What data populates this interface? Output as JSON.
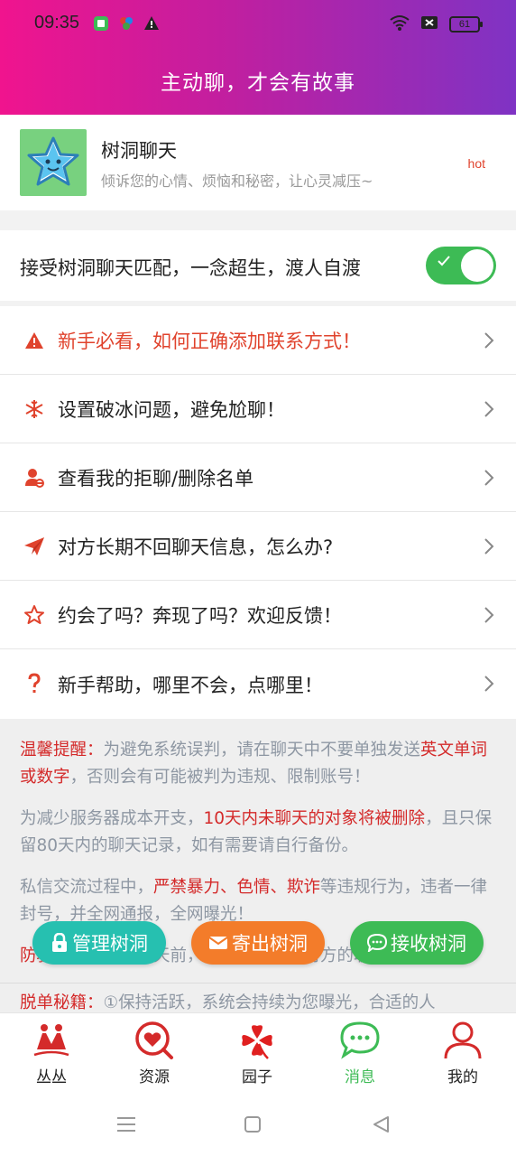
{
  "status": {
    "time": "09:35",
    "battery": "61"
  },
  "header": {
    "title": "主动聊，才会有故事"
  },
  "treehole": {
    "name": "树洞聊天",
    "desc": "倾诉您的心情、烦恼和秘密，让心灵减压~",
    "badge": "hot"
  },
  "toggle": {
    "label": "接受树洞聊天匹配，一念超生，渡人自渡",
    "on": true
  },
  "menu": [
    {
      "label": "新手必看，如何正确添加联系方式！",
      "icon": "warning-icon"
    },
    {
      "label": "设置破冰问题，避免尬聊！",
      "icon": "snowflake-icon"
    },
    {
      "label": "查看我的拒聊/删除名单",
      "icon": "user-block-icon"
    },
    {
      "label": "对方长期不回聊天信息，怎么办?",
      "icon": "paper-plane-icon"
    },
    {
      "label": "约会了吗？奔现了吗？欢迎反馈！",
      "icon": "star-icon"
    },
    {
      "label": "新手帮助，哪里不会，点哪里！",
      "icon": "question-icon"
    }
  ],
  "notice": {
    "p1": {
      "a": "温馨提醒：",
      "b": "为避免系统误判，请在聊天中不要单独发送",
      "c": "英文单词或数字",
      "d": "，否则会有可能被判为违规、限制账号！"
    },
    "p2": {
      "a": "为减少服务器成本开支，",
      "b": "10天内未聊天的对象将被删除",
      "c": "，且只保留80天内的聊天记录，如有需要请自行备份。"
    },
    "p3": {
      "a": "私信交流过程中，",
      "b": "严禁暴力、色情、欺诈",
      "c": "等违规行为，违者一律封号，并全网通报，全网曝光！"
    },
    "p4": {
      "a": "防骗提示：",
      "b": "与人聊天前，请务必留一下对方的联系方式！"
    },
    "p5": {
      "a": "脱单秘籍：",
      "b": "①保持活跃，系统会持续为您曝光，合适的人"
    }
  },
  "fabs": {
    "manage": "管理树洞",
    "send": "寄出树洞",
    "receive": "接收树洞"
  },
  "tabs": [
    {
      "label": "丛丛",
      "icon": "couple-icon"
    },
    {
      "label": "资源",
      "icon": "heart-search-icon"
    },
    {
      "label": "园子",
      "icon": "clover-icon"
    },
    {
      "label": "消息",
      "icon": "chat-bubble-icon",
      "active": true
    },
    {
      "label": "我的",
      "icon": "person-icon"
    }
  ],
  "colors": {
    "accent": "#3dbb55",
    "warn": "#e0432d",
    "header_start": "#f0148e",
    "header_end": "#7f33c4"
  }
}
